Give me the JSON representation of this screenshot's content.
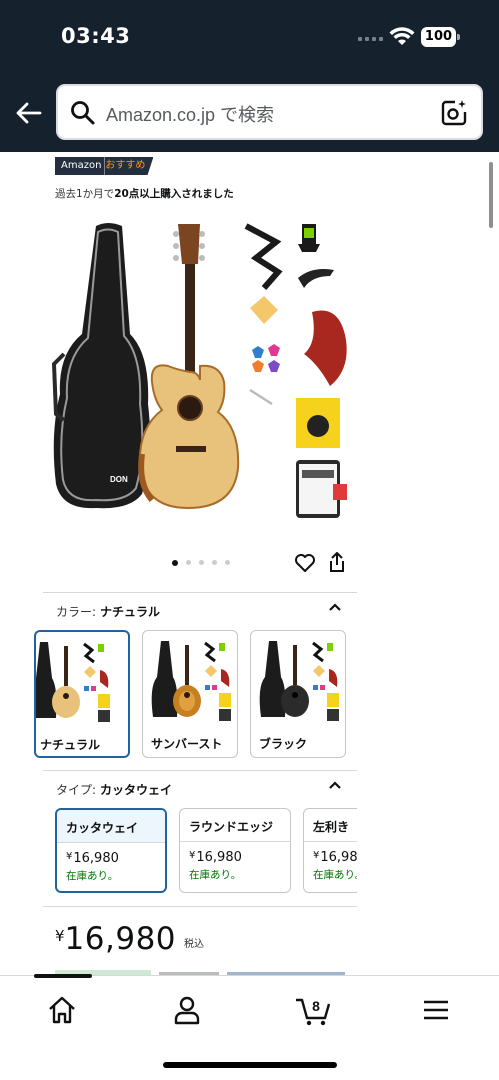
{
  "status_bar": {
    "time": "03:43",
    "battery": "100"
  },
  "search": {
    "placeholder": "Amazon.co.jp で検索"
  },
  "badge": {
    "brand": "Amazon",
    "label": "おすすめ"
  },
  "bought": {
    "prefix": "過去1か月で",
    "count": "20点以上購入されました"
  },
  "carousel": {
    "total": 5,
    "active": 0
  },
  "color_section": {
    "label": "カラー:",
    "selected": "ナチュラル",
    "options": [
      {
        "name": "ナチュラル",
        "body_color": "#e8c27a"
      },
      {
        "name": "サンバースト",
        "body_color": "#c6801f"
      },
      {
        "name": "ブラック",
        "body_color": "#2b2b2b"
      }
    ]
  },
  "type_section": {
    "label": "タイプ:",
    "selected": "カッタウェイ",
    "options": [
      {
        "name": "カッタウェイ",
        "price": "16,980",
        "stock": "在庫あり。"
      },
      {
        "name": "ラウンドエッジ",
        "price": "16,980",
        "stock": "在庫あり。"
      },
      {
        "name": "左利き",
        "price": "16,98",
        "stock": "在庫あり。"
      }
    ]
  },
  "price": {
    "currency": "¥",
    "value": "16,980",
    "tax": "税込"
  },
  "bottom_nav": {
    "cart_count": "8"
  },
  "colors": {
    "header_bg": "#16212e",
    "accent": "#2162a1",
    "stock_green": "#007600",
    "badge_orange": "#ff9900"
  }
}
